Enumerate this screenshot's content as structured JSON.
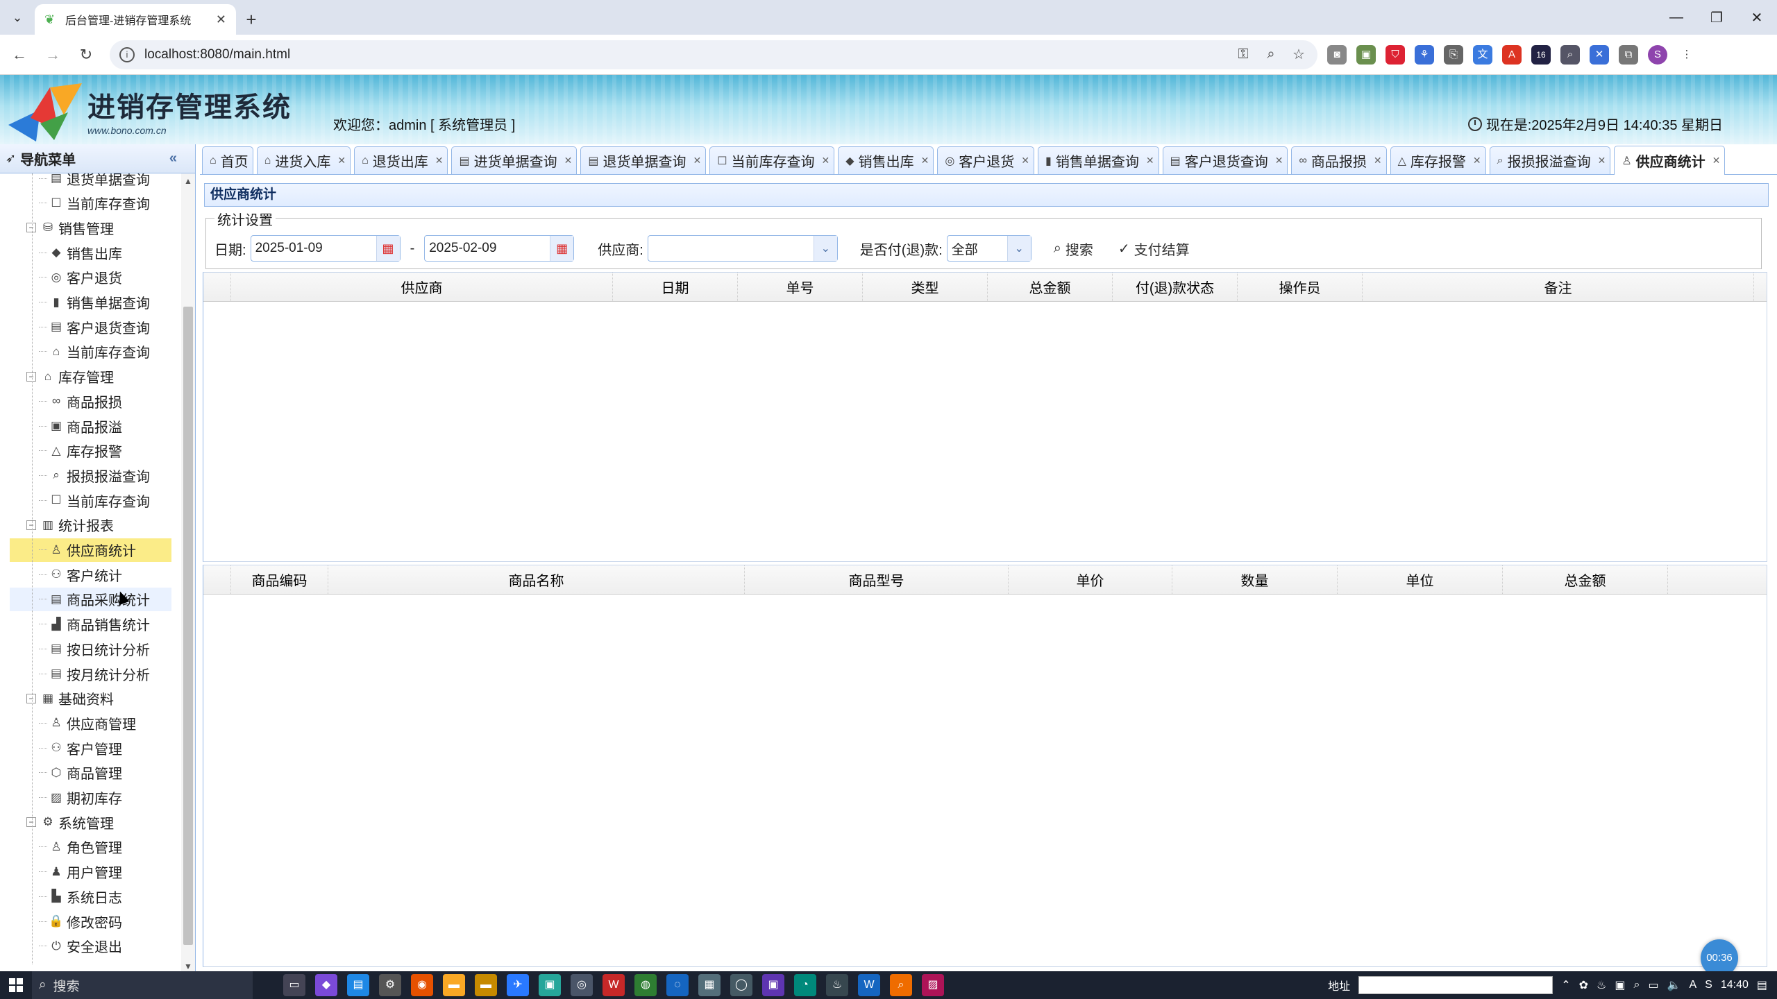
{
  "browser": {
    "tab_title": "后台管理-进销存管理系统",
    "url": "localhost:8080/main.html",
    "profile_initial": "S",
    "ext_badge": "16"
  },
  "app": {
    "logo_text": "进销存管理系统",
    "logo_sub": "www.bono.com.cn",
    "welcome": "欢迎您：admin [ 系统管理员 ]",
    "clock": "现在是:2025年2月9日 14:40:35 星期日"
  },
  "sidebar": {
    "title": "导航菜单",
    "rows": [
      {
        "label": "退货单据查询",
        "kind": "leaf",
        "icon": "▤"
      },
      {
        "label": "当前库存查询",
        "kind": "leaf",
        "icon": "☐"
      },
      {
        "label": "销售管理",
        "kind": "group",
        "icon": "⛁"
      },
      {
        "label": "销售出库",
        "kind": "leaf",
        "icon": "◆"
      },
      {
        "label": "客户退货",
        "kind": "leaf",
        "icon": "◎"
      },
      {
        "label": "销售单据查询",
        "kind": "leaf",
        "icon": "▮"
      },
      {
        "label": "客户退货查询",
        "kind": "leaf",
        "icon": "▤"
      },
      {
        "label": "当前库存查询",
        "kind": "leaf",
        "icon": "⌂"
      },
      {
        "label": "库存管理",
        "kind": "group",
        "icon": "⌂"
      },
      {
        "label": "商品报损",
        "kind": "leaf",
        "icon": "∞"
      },
      {
        "label": "商品报溢",
        "kind": "leaf",
        "icon": "▣"
      },
      {
        "label": "库存报警",
        "kind": "leaf",
        "icon": "△"
      },
      {
        "label": "报损报溢查询",
        "kind": "leaf",
        "icon": "⌕"
      },
      {
        "label": "当前库存查询",
        "kind": "leaf",
        "icon": "☐"
      },
      {
        "label": "统计报表",
        "kind": "group",
        "icon": "▥"
      },
      {
        "label": "供应商统计",
        "kind": "leaf",
        "icon": "♙"
      },
      {
        "label": "客户统计",
        "kind": "leaf",
        "icon": "⚇"
      },
      {
        "label": "商品采购统计",
        "kind": "leaf",
        "icon": "▤"
      },
      {
        "label": "商品销售统计",
        "kind": "leaf",
        "icon": "▟"
      },
      {
        "label": "按日统计分析",
        "kind": "leaf",
        "icon": "▤"
      },
      {
        "label": "按月统计分析",
        "kind": "leaf",
        "icon": "▤"
      },
      {
        "label": "基础资料",
        "kind": "group",
        "icon": "▦"
      },
      {
        "label": "供应商管理",
        "kind": "leaf",
        "icon": "♙"
      },
      {
        "label": "客户管理",
        "kind": "leaf",
        "icon": "⚇"
      },
      {
        "label": "商品管理",
        "kind": "leaf",
        "icon": "⬡"
      },
      {
        "label": "期初库存",
        "kind": "leaf",
        "icon": "▨"
      },
      {
        "label": "系统管理",
        "kind": "group",
        "icon": "⚙"
      },
      {
        "label": "角色管理",
        "kind": "leaf",
        "icon": "♙"
      },
      {
        "label": "用户管理",
        "kind": "leaf",
        "icon": "♟"
      },
      {
        "label": "系统日志",
        "kind": "leaf",
        "icon": "▙"
      },
      {
        "label": "修改密码",
        "kind": "leaf",
        "icon": "🔒"
      },
      {
        "label": "安全退出",
        "kind": "leaf",
        "icon": "⏻"
      }
    ]
  },
  "tabs": [
    {
      "label": "首页",
      "icon": "⌂",
      "closable": false
    },
    {
      "label": "进货入库",
      "icon": "⌂",
      "closable": true
    },
    {
      "label": "退货出库",
      "icon": "⌂",
      "closable": true
    },
    {
      "label": "进货单据查询",
      "icon": "▤",
      "closable": true
    },
    {
      "label": "退货单据查询",
      "icon": "▤",
      "closable": true
    },
    {
      "label": "当前库存查询",
      "icon": "☐",
      "closable": true
    },
    {
      "label": "销售出库",
      "icon": "◆",
      "closable": true
    },
    {
      "label": "客户退货",
      "icon": "◎",
      "closable": true
    },
    {
      "label": "销售单据查询",
      "icon": "▮",
      "closable": true
    },
    {
      "label": "客户退货查询",
      "icon": "▤",
      "closable": true
    },
    {
      "label": "商品报损",
      "icon": "∞",
      "closable": true
    },
    {
      "label": "库存报警",
      "icon": "△",
      "closable": true
    },
    {
      "label": "报损报溢查询",
      "icon": "⌕",
      "closable": true
    },
    {
      "label": "供应商统计",
      "icon": "♙",
      "closable": true,
      "active": true
    }
  ],
  "panel": {
    "title": "供应商统计",
    "legend": "统计设置",
    "date_label": "日期:",
    "date_from": "2025-01-09",
    "date_sep": "-",
    "date_to": "2025-02-09",
    "supplier_label": "供应商:",
    "supplier_value": "",
    "paid_label": "是否付(退)款:",
    "paid_value": "全部",
    "search_label": "搜索",
    "settle_label": "支付结算"
  },
  "grid1": {
    "columns": [
      "供应商",
      "日期",
      "单号",
      "类型",
      "总金额",
      "付(退)款状态",
      "操作员",
      "备注"
    ]
  },
  "grid2": {
    "columns": [
      "商品编码",
      "商品名称",
      "商品型号",
      "单价",
      "数量",
      "单位",
      "总金额"
    ]
  },
  "taskbar": {
    "search": "搜索",
    "addr_label": "地址",
    "time": "14:40",
    "timer": "00:36"
  }
}
